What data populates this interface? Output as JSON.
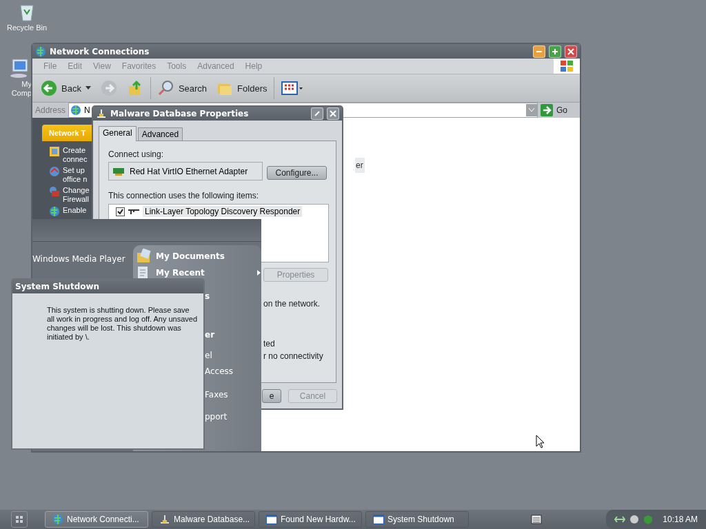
{
  "desktop_icons": [
    {
      "label": "Recycle Bin",
      "kind": "recycle"
    },
    {
      "label": "My Comp",
      "kind": "computer"
    }
  ],
  "network_window": {
    "title": "Network Connections",
    "menu": [
      {
        "label": "File",
        "disabled": true
      },
      {
        "label": "Edit",
        "disabled": true
      },
      {
        "label": "View",
        "disabled": true
      },
      {
        "label": "Favorites",
        "disabled": true
      },
      {
        "label": "Tools",
        "disabled": true
      },
      {
        "label": "Advanced",
        "disabled": true
      },
      {
        "label": "Help",
        "disabled": true
      }
    ],
    "toolbar": [
      {
        "kind": "back",
        "label": "Back"
      },
      {
        "kind": "forward"
      },
      {
        "kind": "up"
      },
      {
        "kind": "search",
        "label": "Search"
      },
      {
        "kind": "folders",
        "label": "Folders"
      },
      {
        "kind": "views"
      }
    ],
    "address": {
      "label": "Address",
      "value": "N",
      "go": "Go"
    },
    "task_pane": {
      "header": "Network T",
      "items": [
        {
          "kind": "create",
          "lines": [
            "Create",
            "connec"
          ]
        },
        {
          "kind": "home",
          "lines": [
            "Set up",
            "office n"
          ]
        },
        {
          "kind": "firewall",
          "lines": [
            "Change",
            "Firewall"
          ]
        },
        {
          "kind": "enable",
          "lines": [
            "Enable"
          ]
        }
      ]
    },
    "content_fragment": "er"
  },
  "properties_dialog": {
    "title": "Malware Database Properties",
    "tabs": [
      {
        "label": "General",
        "selected": true
      },
      {
        "label": "Advanced",
        "selected": false
      }
    ],
    "connect_label": "Connect using:",
    "adapter": "Red Hat VirtIO Ethernet Adapter",
    "configure": "Configure...",
    "items_label": "This connection uses the following items:",
    "items": [
      {
        "label": "Link-Layer Topology Discovery Responder",
        "checked": true
      }
    ],
    "properties_button": {
      "label": "Properties",
      "disabled": true
    },
    "fragments": [
      "on the network.",
      "ted",
      "r no connectivity"
    ],
    "buttons": [
      {
        "label": "e",
        "disabled": false
      },
      {
        "label": "Cancel",
        "disabled": true
      }
    ]
  },
  "start_menu": {
    "left_items": [
      "Windows Media Player"
    ],
    "right_items": [
      {
        "label": "My Documents",
        "kind": "documents",
        "submenu": false
      },
      {
        "label": "My Recent",
        "kind": "recent",
        "submenu": true
      }
    ],
    "fragments": [
      "s",
      "er",
      "el",
      "Access",
      "Faxes",
      "pport"
    ]
  },
  "shutdown_dialog": {
    "title": "System Shutdown",
    "message": "This system is shutting down. Please save all work in progress and log off. Any unsaved changes will be lost. This shutdown was initiated by \\."
  },
  "taskbar": {
    "tasks": [
      {
        "label": "Network Connecti...",
        "kind": "network",
        "selected": true
      },
      {
        "label": "Malware Database...",
        "kind": "network-small",
        "selected": false
      },
      {
        "label": "Found New Hardw...",
        "kind": "window",
        "selected": false
      },
      {
        "label": "System Shutdown",
        "kind": "window",
        "selected": false
      }
    ],
    "clock": "10:18 AM"
  }
}
